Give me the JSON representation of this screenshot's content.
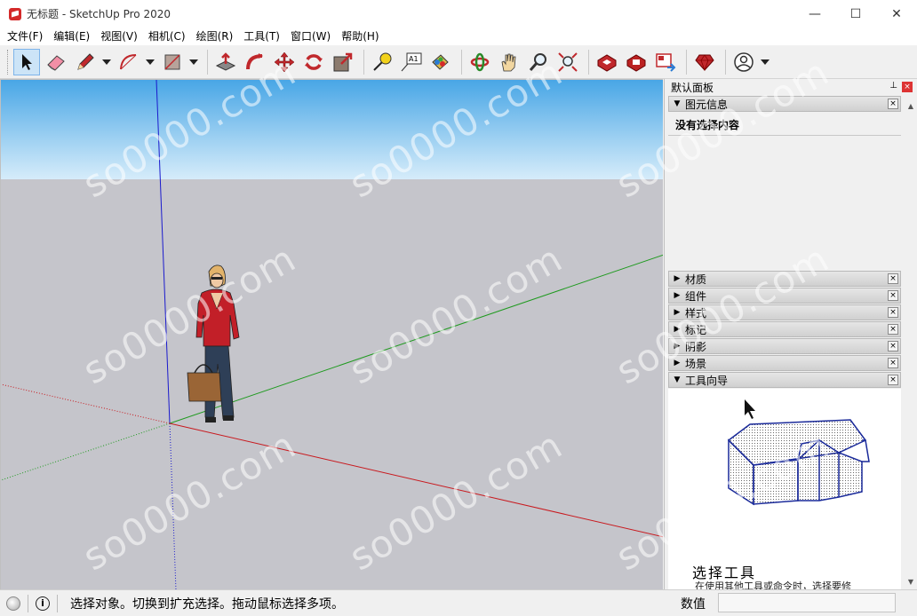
{
  "window": {
    "title": "无标题 - SketchUp Pro 2020",
    "minimize": "—",
    "maximize": "☐",
    "close": "✕"
  },
  "menu": [
    "文件(F)",
    "编辑(E)",
    "视图(V)",
    "相机(C)",
    "绘图(R)",
    "工具(T)",
    "窗口(W)",
    "帮助(H)"
  ],
  "toolbar": {
    "tools": [
      "select-icon",
      "eraser-icon",
      "pencil-icon",
      "arc-icon",
      "rectangle-icon",
      "push-pull-icon",
      "follow-me-icon",
      "move-icon",
      "rotate-icon",
      "scale-icon",
      "tape-measure-icon",
      "text-icon",
      "paint-bucket-icon",
      "orbit-icon",
      "pan-icon",
      "zoom-icon",
      "zoom-extents-icon",
      "warehouse-icon",
      "extension-warehouse-icon",
      "layout-icon",
      "ruby-icon",
      "account-icon"
    ],
    "text_tool_label": "A1"
  },
  "panel": {
    "title": "默认面板",
    "pin": "⊥",
    "close": "×",
    "entity_info": {
      "label": "图元信息",
      "content": "没有选择内容"
    },
    "trays": [
      {
        "label": "材质"
      },
      {
        "label": "组件"
      },
      {
        "label": "样式"
      },
      {
        "label": "标记"
      },
      {
        "label": "阴影"
      },
      {
        "label": "场景"
      }
    ],
    "instructor": {
      "label": "工具向导",
      "title": "选择工具",
      "desc": "在使用其他工具或命令时，选择要修"
    }
  },
  "status": {
    "message": "选择对象。切换到扩充选择。拖动鼠标选择多项。",
    "value_label": "数值",
    "value": ""
  },
  "watermark": "so0000.com",
  "colors": {
    "sky_top": "#48a6e6",
    "ground": "#c5c5cb",
    "axis_red": "#c8191e",
    "axis_green": "#1f9a1f",
    "axis_blue": "#1a1acd"
  }
}
